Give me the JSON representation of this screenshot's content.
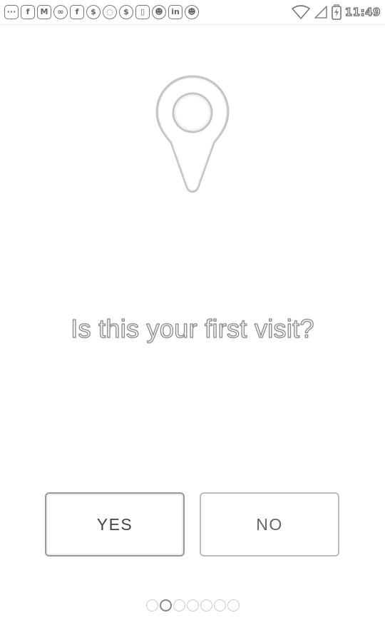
{
  "status_bar": {
    "time": "11:49",
    "notification_icons": [
      {
        "name": "messages-icon",
        "glyph": "···"
      },
      {
        "name": "facebook-icon",
        "glyph": "f"
      },
      {
        "name": "gmail-icon",
        "glyph": "M"
      },
      {
        "name": "infinity-icon",
        "glyph": "∞"
      },
      {
        "name": "facebook-icon",
        "glyph": "f"
      },
      {
        "name": "money-bag-icon",
        "glyph": "$"
      },
      {
        "name": "whatsapp-icon",
        "glyph": "◌"
      },
      {
        "name": "money-bag-icon",
        "glyph": "$"
      },
      {
        "name": "sim-card-icon",
        "glyph": "▯"
      },
      {
        "name": "game-icon",
        "glyph": "☻"
      },
      {
        "name": "linkedin-icon",
        "glyph": "in"
      },
      {
        "name": "game-icon",
        "glyph": "☻"
      }
    ]
  },
  "main": {
    "question": "Is this your first visit?",
    "yes_label": "YES",
    "no_label": "NO"
  },
  "pager": {
    "total": 7,
    "active_index": 1
  },
  "colors": {
    "background": "#ffffff",
    "outline": "#aaaaaa",
    "text": "#444444"
  }
}
